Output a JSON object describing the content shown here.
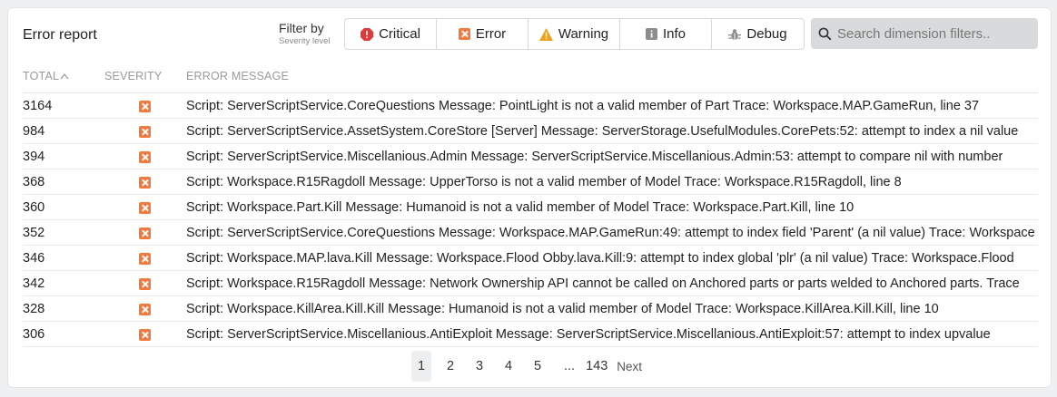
{
  "header": {
    "title": "Error report",
    "filter_label": "Filter by",
    "filter_sublabel": "Severity level"
  },
  "filters": [
    {
      "label": "Critical",
      "icon": "critical-icon",
      "color": "#e03a3a"
    },
    {
      "label": "Error",
      "icon": "error-icon",
      "color": "#f07a3d"
    },
    {
      "label": "Warning",
      "icon": "warning-icon",
      "color": "#f0a020"
    },
    {
      "label": "Info",
      "icon": "info-icon",
      "color": "#8c8c8c"
    },
    {
      "label": "Debug",
      "icon": "debug-icon",
      "color": "#8c8c8c"
    }
  ],
  "search": {
    "placeholder": "Search dimension filters.."
  },
  "table": {
    "columns": {
      "total": "TOTAL",
      "severity": "SEVERITY",
      "message": "ERROR MESSAGE"
    },
    "rows": [
      {
        "total": "3164",
        "message": "Script: ServerScriptService.CoreQuestions Message: PointLight is not a valid member of Part Trace: Workspace.MAP.GameRun, line 37"
      },
      {
        "total": "984",
        "message": "Script: ServerScriptService.AssetSystem.CoreStore [Server] Message: ServerStorage.UsefulModules.CorePets:52: attempt to index a nil value"
      },
      {
        "total": "394",
        "message": "Script: ServerScriptService.Miscellanious.Admin Message: ServerScriptService.Miscellanious.Admin:53: attempt to compare nil with number"
      },
      {
        "total": "368",
        "message": "Script: Workspace.R15Ragdoll Message: UpperTorso is not a valid member of Model Trace: Workspace.R15Ragdoll, line 8"
      },
      {
        "total": "360",
        "message": "Script: Workspace.Part.Kill Message: Humanoid is not a valid member of Model Trace: Workspace.Part.Kill, line 10"
      },
      {
        "total": "352",
        "message": "Script: ServerScriptService.CoreQuestions Message: Workspace.MAP.GameRun:49: attempt to index field 'Parent' (a nil value) Trace: Workspace"
      },
      {
        "total": "346",
        "message": "Script: Workspace.MAP.lava.Kill Message: Workspace.Flood Obby.lava.Kill:9: attempt to index global 'plr' (a nil value) Trace: Workspace.Flood"
      },
      {
        "total": "342",
        "message": "Script: Workspace.R15Ragdoll Message: Network Ownership API cannot be called on Anchored parts or parts welded to Anchored parts. Trace"
      },
      {
        "total": "328",
        "message": "Script: Workspace.KillArea.Kill.Kill Message: Humanoid is not a valid member of Model Trace: Workspace.KillArea.Kill.Kill, line 10"
      },
      {
        "total": "306",
        "message": "Script: ServerScriptService.Miscellanious.AntiExploit Message: ServerScriptService.Miscellanious.AntiExploit:57: attempt to index upvalue"
      }
    ]
  },
  "pagination": {
    "pages": [
      "1",
      "2",
      "3",
      "4",
      "5"
    ],
    "ellipsis": "...",
    "last": "143",
    "next": "Next",
    "current": "1"
  }
}
